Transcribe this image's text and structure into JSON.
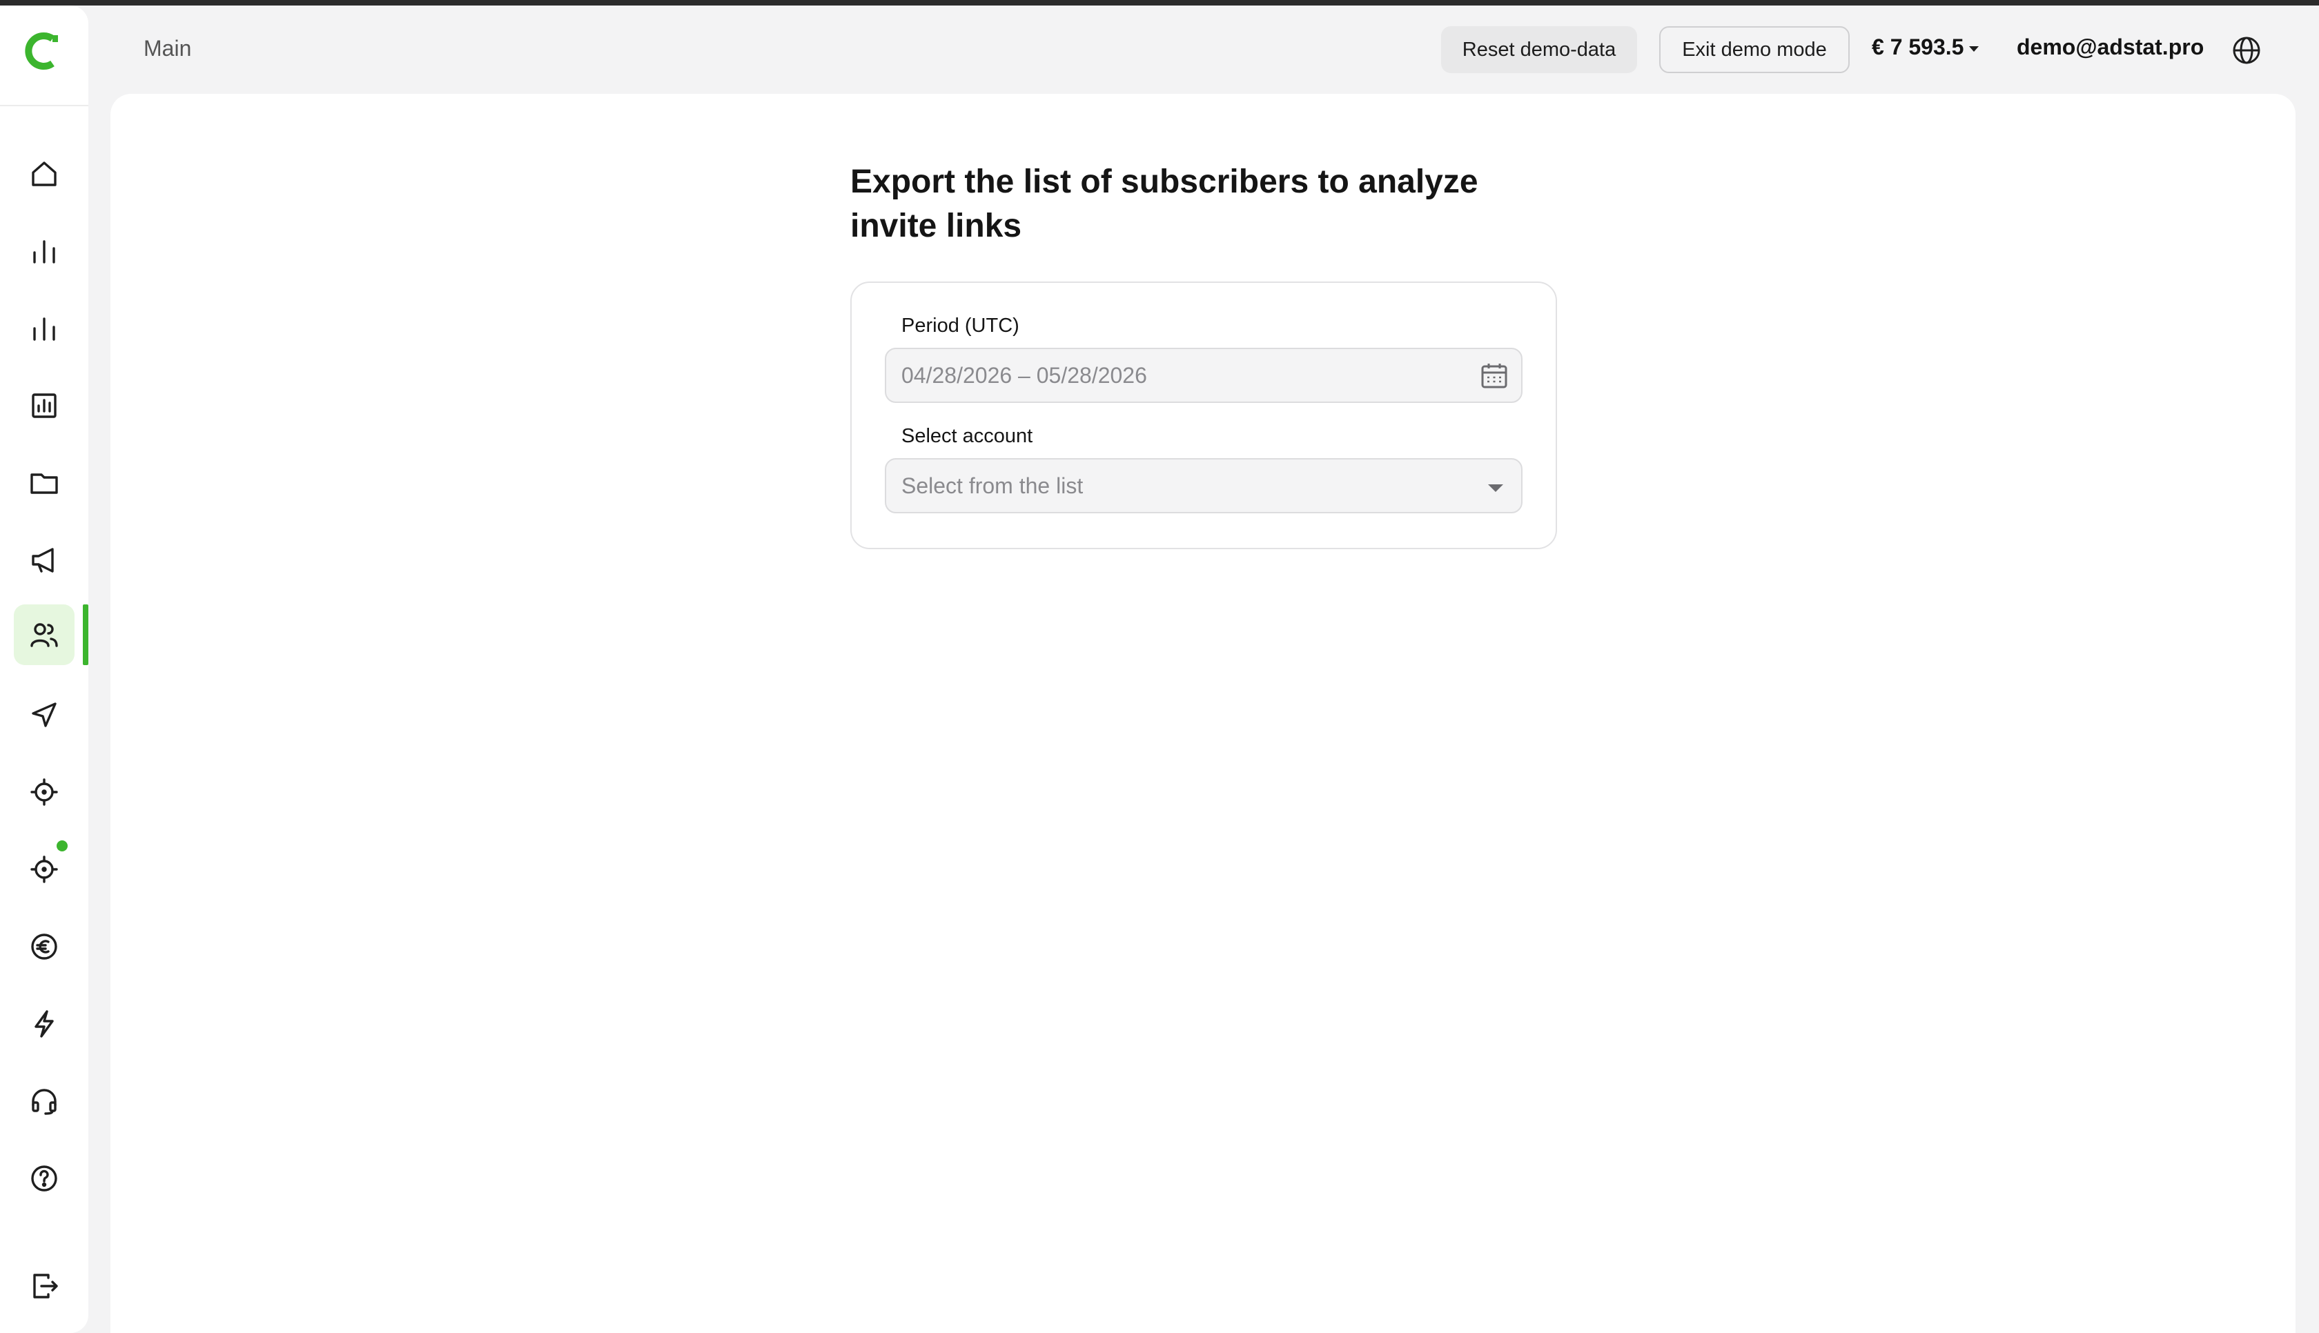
{
  "header": {
    "breadcrumb": "Main",
    "reset_label": "Reset demo-data",
    "exit_label": "Exit demo mode",
    "balance": "€ 7 593.5",
    "email": "demo@adstat.pro"
  },
  "main": {
    "title": "Export the list of subscribers to analyze invite links",
    "period_label": "Period (UTC)",
    "period_value": "04/28/2026 – 05/28/2026",
    "account_label": "Select account",
    "account_placeholder": "Select from the list"
  },
  "sidebar": {
    "items": [
      "home-icon",
      "bar-chart-icon",
      "bar-chart-alt-icon",
      "report-icon",
      "folder-icon",
      "megaphone-icon",
      "users-icon",
      "send-icon",
      "target-icon",
      "target-notify-icon",
      "euro-icon",
      "lightning-icon",
      "headset-icon",
      "help-icon",
      "logout-icon"
    ],
    "active": "users-icon"
  },
  "colors": {
    "accent": "#3cb52e",
    "active_bg": "#e6f7df"
  }
}
